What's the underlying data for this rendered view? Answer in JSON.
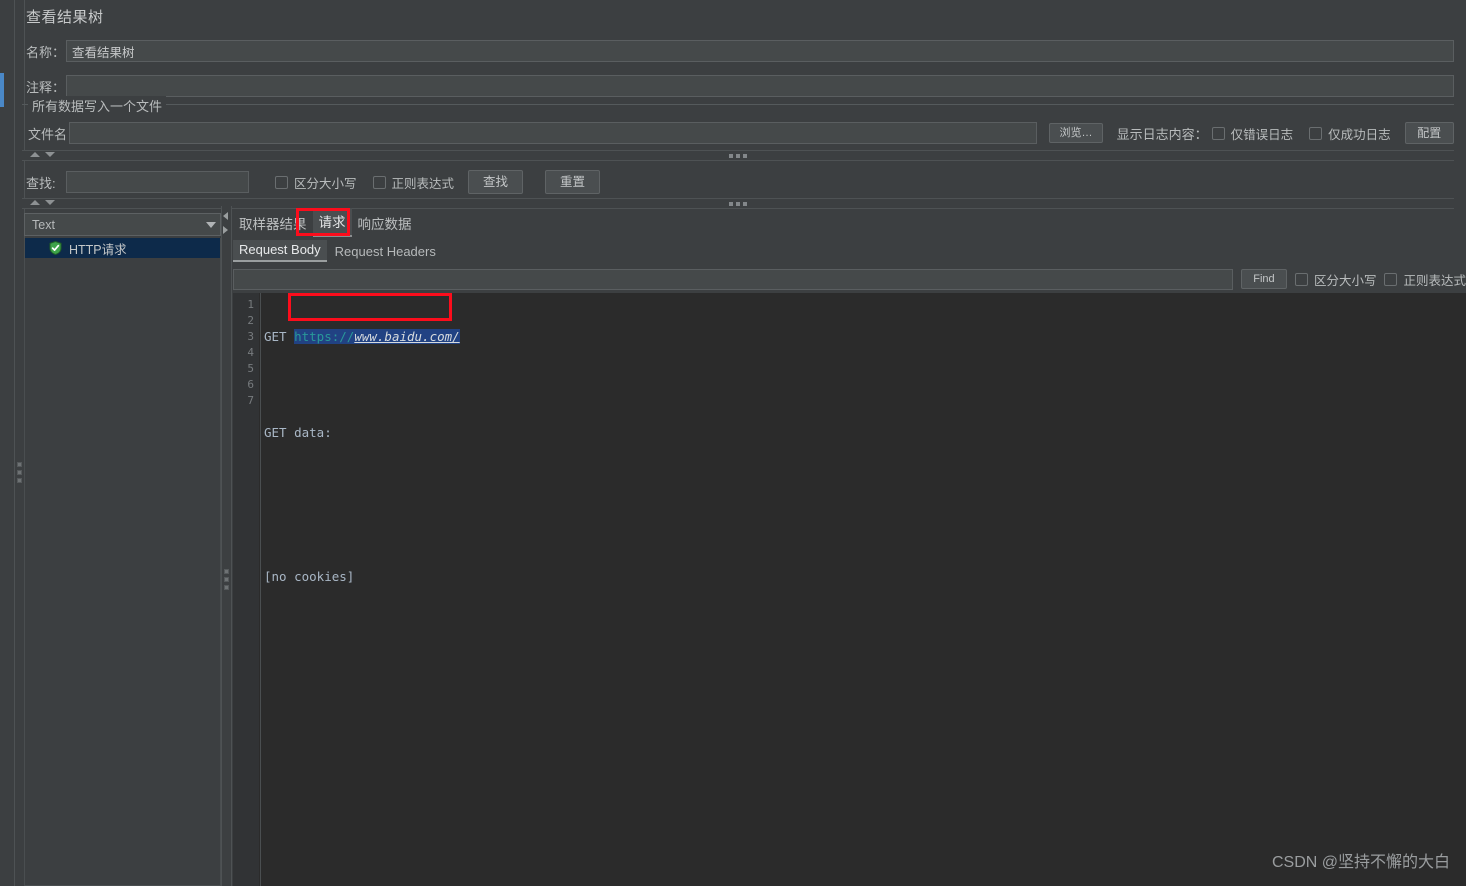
{
  "window": {
    "panel_title": "查看结果树"
  },
  "form": {
    "name_label": "名称：",
    "name_value": "查看结果树",
    "comment_label": "注释：",
    "comment_value": "",
    "group_legend": "所有数据写入一个文件",
    "filename_label": "文件名",
    "filename_value": "",
    "browse_button": "浏览…",
    "log_display_label": "显示日志内容：",
    "only_error_log": "仅错误日志",
    "only_success_log": "仅成功日志",
    "configure_button": "配置"
  },
  "search": {
    "label": "查找:",
    "value": "",
    "match_case": "区分大小写",
    "regex": "正则表达式",
    "find_button": "查找",
    "reset_button": "重置"
  },
  "viewer": {
    "render_type": "Text",
    "tree": {
      "items": [
        {
          "label": "HTTP请求",
          "icon": "shield-success-icon",
          "selected": true
        }
      ]
    },
    "tabs": [
      {
        "label": "取样器结果",
        "active": false
      },
      {
        "label": "请求",
        "active": true
      },
      {
        "label": "响应数据",
        "active": false
      }
    ],
    "subtabs": [
      {
        "label": "Request Body",
        "active": true
      },
      {
        "label": "Request Headers",
        "active": false
      }
    ],
    "findbar": {
      "value": "",
      "find_button": "Find",
      "match_case": "区分大小写",
      "regex": "正则表达式"
    },
    "editor": {
      "line_numbers": [
        "1",
        "2",
        "3",
        "4",
        "5",
        "6",
        "7"
      ],
      "lines": [
        {
          "prefix": "GET ",
          "scheme": "https://",
          "url": "www.baidu.com/",
          "selected": true
        },
        {
          "prefix": ""
        },
        {
          "prefix": "GET data:"
        },
        {
          "prefix": ""
        },
        {
          "prefix": ""
        },
        {
          "prefix": "[no cookies]"
        },
        {
          "prefix": ""
        }
      ],
      "line1_text": "GET ",
      "line1_scheme": "https://",
      "line1_url": "www.baidu.com/",
      "line3_text": "GET data:",
      "line6_text": "[no cookies]"
    }
  },
  "watermark": {
    "text": "CSDN @坚持不懈的大白"
  },
  "colors": {
    "background": "#3c3f41",
    "editor_background": "#2b2b2b",
    "accent_blue": "#4a88c7",
    "selection_blue": "#214283",
    "tree_selection": "#0d2a4a",
    "annotation_red": "#fc0d1c",
    "scheme_teal": "#299999"
  }
}
